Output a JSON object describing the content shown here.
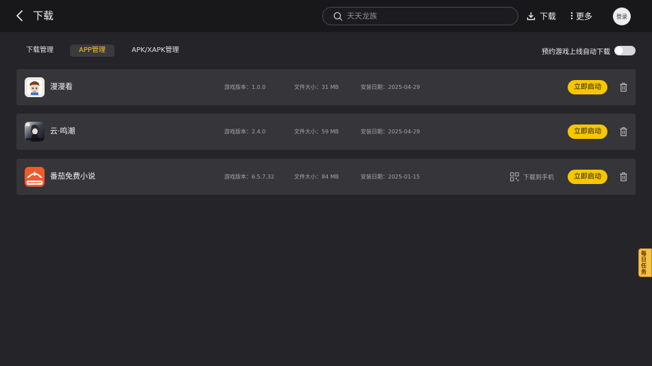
{
  "header": {
    "title": "下载",
    "search_placeholder": "天天龙族",
    "download_label": "下载",
    "more_label": "更多",
    "login_label": "登录"
  },
  "tabs": [
    {
      "label": "下载管理",
      "active": false
    },
    {
      "label": "APP管理",
      "active": true
    },
    {
      "label": "APK/XAPK管理",
      "active": false
    }
  ],
  "auto_download": {
    "label": "预约游戏上线自动下载",
    "enabled": false
  },
  "apps": [
    {
      "name": "漫漫看",
      "version": "游戏版本：1.0.0",
      "size": "文件大小：31 MB",
      "date": "安装日期：2025-04-29",
      "icon": "manmankan-app-icon",
      "to_phone": "",
      "launch": "立即启动"
    },
    {
      "name": "云·鸣潮",
      "version": "游戏版本：2.4.0",
      "size": "文件大小：59 MB",
      "date": "安装日期：2025-04-29",
      "icon": "mingchao-app-icon",
      "to_phone": "",
      "launch": "立即启动"
    },
    {
      "name": "番茄免费小说",
      "version": "游戏版本：6.5.7.32",
      "size": "文件大小：84 MB",
      "date": "安装日期：2025-01-15",
      "icon": "fanqie-app-icon",
      "to_phone": "下载到手机",
      "launch": "立即启动"
    }
  ],
  "daily_task": {
    "label": "每日任务"
  },
  "colors": {
    "accent": "#f7c600",
    "active_tab_text": "#f5c518",
    "card_bg": "#36353a",
    "page_bg": "#252428",
    "topbar_bg": "#18181b"
  }
}
